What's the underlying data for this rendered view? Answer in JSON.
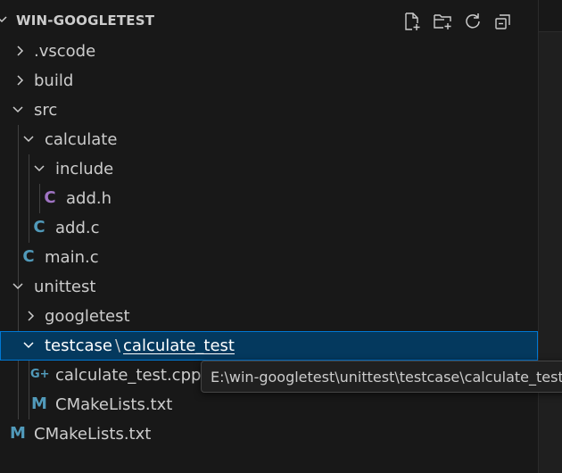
{
  "explorer": {
    "title": "WIN-GOOGLETEST",
    "toolbar": {
      "new_file_icon": "new-file-icon",
      "new_folder_icon": "new-folder-icon",
      "refresh_icon": "refresh-icon",
      "collapse_icon": "collapse-all-icon"
    },
    "items": [
      {
        "label": ".vscode",
        "type": "folder",
        "expanded": false
      },
      {
        "label": "build",
        "type": "folder",
        "expanded": false
      },
      {
        "label": "src",
        "type": "folder",
        "expanded": true
      },
      {
        "label": "calculate",
        "type": "folder",
        "expanded": true
      },
      {
        "label": "include",
        "type": "folder",
        "expanded": true
      },
      {
        "label": "add.h",
        "type": "file",
        "icon": "C",
        "icon_color": "#a074c4"
      },
      {
        "label": "add.c",
        "type": "file",
        "icon": "C",
        "icon_color": "#519aba"
      },
      {
        "label": "main.c",
        "type": "file",
        "icon": "C",
        "icon_color": "#519aba"
      },
      {
        "label": "unittest",
        "type": "folder",
        "expanded": true
      },
      {
        "label": "googletest",
        "type": "folder",
        "expanded": false
      },
      {
        "label": "testcase",
        "sep": "\\",
        "label2": "calculate_test",
        "type": "folder",
        "expanded": true,
        "selected": true
      },
      {
        "label": "calculate_test.cpp",
        "type": "file",
        "icon": "G+",
        "icon_color": "#519aba"
      },
      {
        "label": "CMakeLists.txt",
        "type": "file",
        "icon": "M",
        "icon_color": "#519aba"
      },
      {
        "label": "CMakeLists.txt",
        "type": "file",
        "icon": "M",
        "icon_color": "#519aba"
      }
    ]
  },
  "tooltip": {
    "text": "E:\\win-googletest\\unittest\\testcase\\calculate_test"
  },
  "colors": {
    "background": "#181818",
    "selection": "#04395e",
    "focus_border": "#0078d4",
    "c_file": "#519aba",
    "h_file": "#a074c4"
  }
}
